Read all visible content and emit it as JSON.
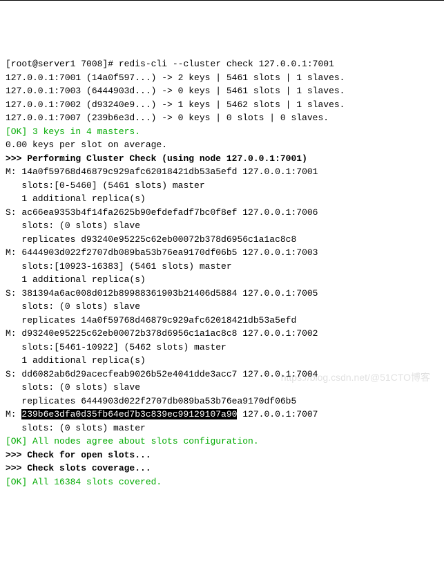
{
  "prompt": "[root@server1 7008]# ",
  "command": "redis-cli --cluster check 127.0.0.1:7001",
  "summary": [
    "127.0.0.1:7001 (14a0f597...) -> 2 keys | 5461 slots | 1 slaves.",
    "127.0.0.1:7003 (6444903d...) -> 0 keys | 5461 slots | 1 slaves.",
    "127.0.0.1:7002 (d93240e9...) -> 1 keys | 5462 slots | 1 slaves.",
    "127.0.0.1:7007 (239b6e3d...) -> 0 keys | 0 slots | 0 slaves."
  ],
  "ok1": "[OK] 3 keys in 4 masters.",
  "avg": "0.00 keys per slot on average.",
  "header": ">>> Performing Cluster Check (using node 127.0.0.1:7001)",
  "nodes": [
    "M: 14a0f59768d46879c929afc62018421db53a5efd 127.0.0.1:7001",
    "   slots:[0-5460] (5461 slots) master",
    "   1 additional replica(s)",
    "S: ac66ea9353b4f14fa2625b90efdefadf7bc0f8ef 127.0.0.1:7006",
    "   slots: (0 slots) slave",
    "   replicates d93240e95225c62eb00072b378d6956c1a1ac8c8",
    "M: 6444903d022f2707db089ba53b76ea9170df06b5 127.0.0.1:7003",
    "   slots:[10923-16383] (5461 slots) master",
    "   1 additional replica(s)",
    "S: 381394a6ac008d012b89988361903b21406d5884 127.0.0.1:7005",
    "   slots: (0 slots) slave",
    "   replicates 14a0f59768d46879c929afc62018421db53a5efd",
    "M: d93240e95225c62eb00072b378d6956c1a1ac8c8 127.0.0.1:7002",
    "   slots:[5461-10922] (5462 slots) master",
    "   1 additional replica(s)",
    "S: dd6082ab6d29acecfeab9026b52e4041dde3acc7 127.0.0.1:7004",
    "   slots: (0 slots) slave",
    "   replicates 6444903d022f2707db089ba53b76ea9170df06b5"
  ],
  "node_m_prefix": "M: ",
  "node_m_highlight": "239b6e3dfa0d35fb64ed7b3c839ec99129107a90",
  "node_m_suffix": " 127.0.0.1:7007",
  "node_m_slots": "   slots: (0 slots) master",
  "ok2": "[OK] All nodes agree about slots configuration.",
  "check_open": ">>> Check for open slots...",
  "check_coverage": ">>> Check slots coverage...",
  "ok3": "[OK] All 16384 slots covered.",
  "watermark": "https://blog.csdn.net/@51CTO博客"
}
